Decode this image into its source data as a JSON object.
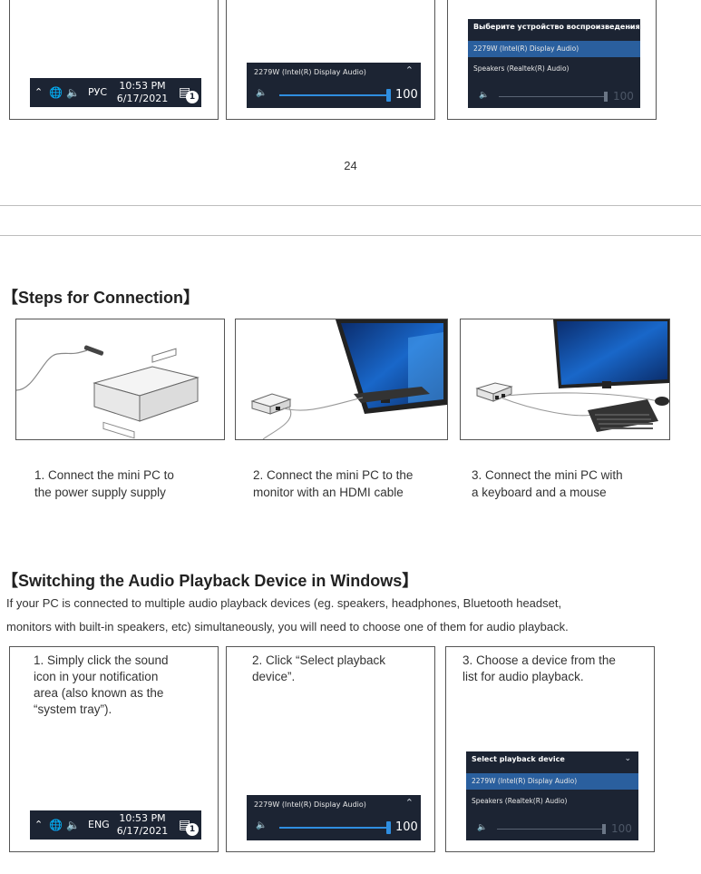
{
  "page_number": "24",
  "top_panels": {
    "p1": {
      "taskbar": {
        "lang": "РУС",
        "time": "10:53 PM",
        "date": "6/17/2021",
        "badge": "1"
      }
    },
    "p2": {
      "flyout": {
        "device": "2279W (Intel(R) Display Audio)",
        "volume": "100"
      }
    },
    "p3": {
      "list": {
        "header": "Выберите устройство воспроизведения",
        "items": [
          "2279W (Intel(R) Display Audio)",
          "Speakers (Realtek(R) Audio)"
        ],
        "volume": "100"
      }
    }
  },
  "connection": {
    "heading": "【Steps for Connection】",
    "steps": [
      {
        "line1": "1. Connect the mini PC to",
        "line2": "the power supply  supply"
      },
      {
        "line1": "2. Connect the mini PC to the",
        "line2": "monitor with an HDMI cable"
      },
      {
        "line1": "3. Connect the mini PC with",
        "line2": "a keyboard and a mouse"
      }
    ]
  },
  "audio": {
    "heading": "【Switching the Audio Playback Device in Windows】",
    "intro_line1": "If your PC is connected to multiple audio playback devices (eg. speakers, headphones, Bluetooth headset,",
    "intro_line2": "monitors with built-in speakers, etc) simultaneously, you will need to choose one of them for audio playback.",
    "steps": [
      {
        "lines": [
          "1. Simply click the sound",
          "icon in your notification",
          "area (also known as the",
          "“system tray”)."
        ]
      },
      {
        "lines": [
          "2. Click “Select playback",
          "device”."
        ]
      },
      {
        "lines": [
          "3. Choose a device from the",
          "list for audio playback."
        ]
      }
    ],
    "taskbar": {
      "lang": "ENG",
      "time": "10:53 PM",
      "date": "6/17/2021",
      "badge": "1"
    },
    "flyout": {
      "device": "2279W (Intel(R) Display Audio)",
      "volume": "100"
    },
    "list": {
      "header": "Select playback device",
      "items": [
        "2279W (Intel(R) Display Audio)",
        "Speakers (Realtek(R) Audio)"
      ],
      "volume": "100"
    }
  }
}
